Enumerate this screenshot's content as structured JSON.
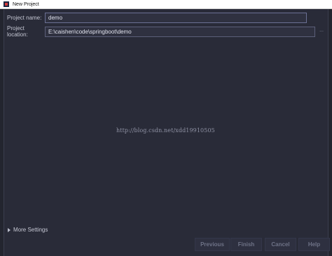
{
  "window": {
    "title": "New Project"
  },
  "form": {
    "name_label": "Project name:",
    "name_value": "demo",
    "location_label": "Project location:",
    "location_value": "E:\\caishen\\code\\springboot\\demo",
    "browse_label": "..."
  },
  "watermark": "http://blog.csdn.net/xdd19910505",
  "more_settings": {
    "label": "More Settings"
  },
  "buttons": {
    "previous": "Previous",
    "finish": "Finish",
    "cancel": "Cancel",
    "help": "Help"
  },
  "colors": {
    "background": "#292b38",
    "titlebar": "#ffffff",
    "disabled_text": "#6e7286"
  }
}
